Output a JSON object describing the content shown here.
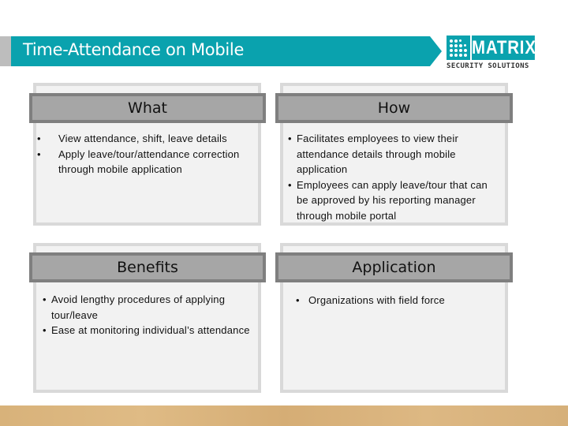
{
  "header": {
    "title": "Time-Attendance on Mobile",
    "accent_color": "#0aa2ae"
  },
  "logo": {
    "icon": "dot-grid-icon",
    "brand": "MATRIX",
    "tagline": "SECURITY SOLUTIONS"
  },
  "panels": [
    {
      "title": "What",
      "bullets": [
        "View attendance, shift, leave details",
        "Apply leave/tour/attendance correction through mobile application"
      ]
    },
    {
      "title": "How",
      "bullets": [
        "Facilitates employees to view their attendance details through mobile application",
        "Employees can apply leave/tour that can be approved by his reporting manager through mobile portal"
      ]
    },
    {
      "title": "Benefits",
      "bullets": [
        "Avoid lengthy procedures of applying tour/leave",
        "Ease at monitoring individual’s attendance"
      ]
    },
    {
      "title": "Application",
      "bullets": [
        "Organizations with field force"
      ]
    }
  ],
  "bullet_glyph": "•"
}
